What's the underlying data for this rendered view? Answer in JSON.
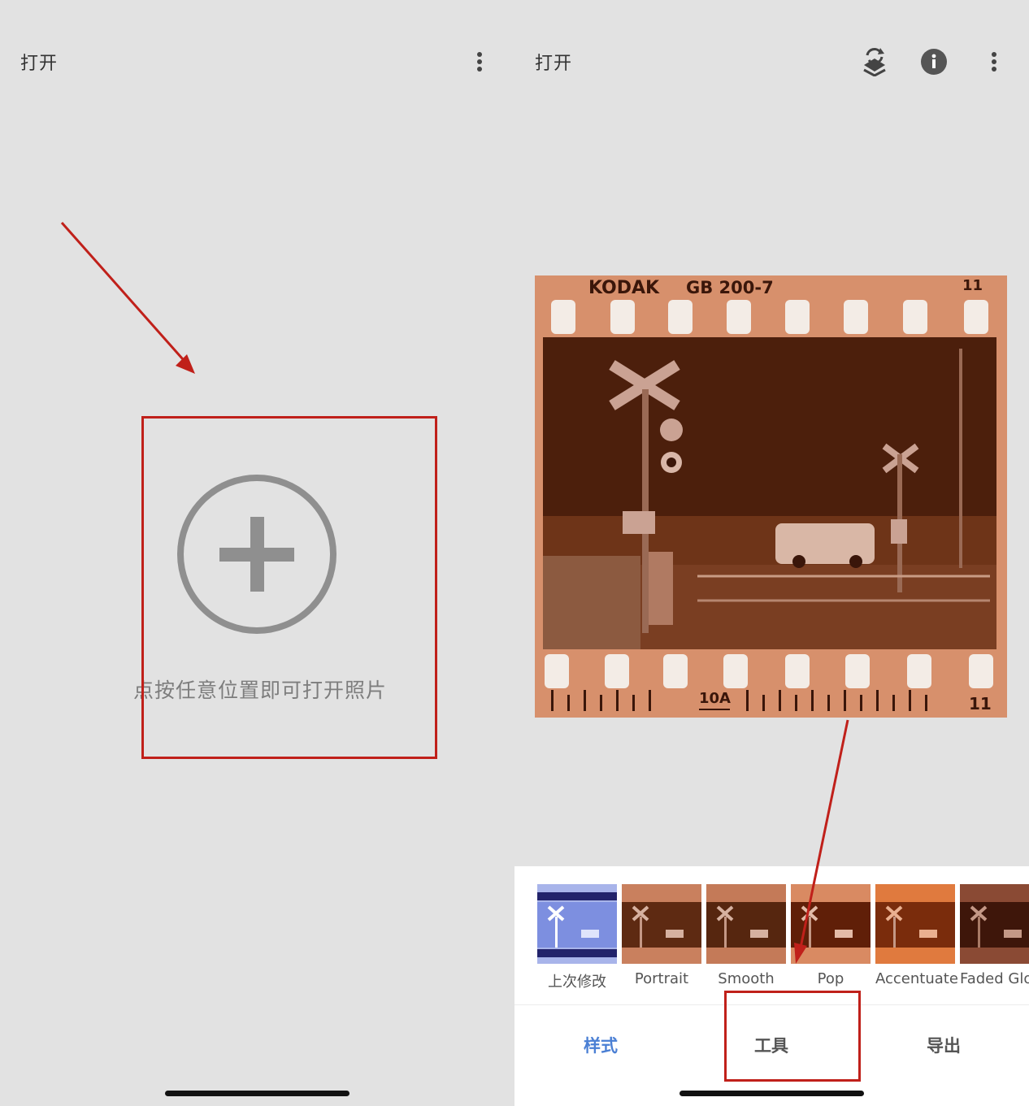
{
  "left": {
    "title": "打开",
    "open_hint": "点按任意位置即可打开照片"
  },
  "right": {
    "title": "打开",
    "photo": {
      "brand": "KODAK",
      "film": "GB 200-7",
      "frame_top": "11",
      "frame_bottom_left": "10A",
      "frame_bottom_right": "11"
    },
    "looks": [
      {
        "label": "上次修改"
      },
      {
        "label": "Portrait"
      },
      {
        "label": "Smooth"
      },
      {
        "label": "Pop"
      },
      {
        "label": "Accentuate"
      },
      {
        "label": "Faded Glow"
      }
    ],
    "nav": {
      "styles": "样式",
      "tools": "工具",
      "export": "导出"
    }
  },
  "colors": {
    "annotation": "#c0201a",
    "accent": "#4a7fd4",
    "background": "#e2e2e2"
  },
  "icons": [
    "more-vert-icon",
    "layers-edit-icon",
    "info-icon",
    "add-circle-icon"
  ]
}
